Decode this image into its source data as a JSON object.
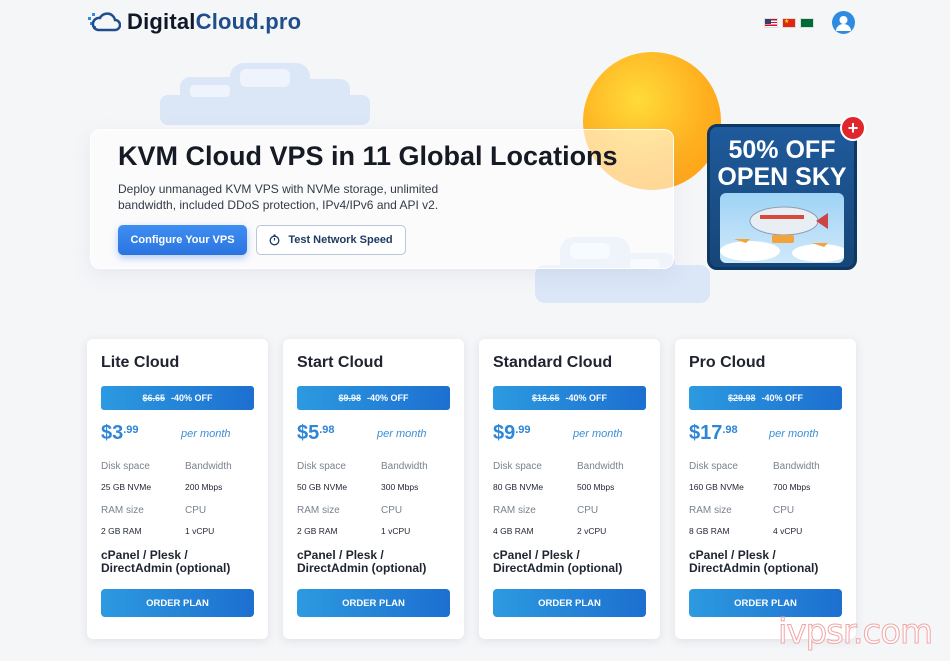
{
  "brand": {
    "name_main": "Digital",
    "name_accent": "Cloud.pro"
  },
  "header": {
    "languages": [
      "English",
      "Chinese",
      "Arabic"
    ],
    "user_icon": "user-icon"
  },
  "hero": {
    "title": "KVM Cloud VPS in 11 Global Locations",
    "description": "Deploy unmanaged KVM VPS with NVMe storage, unlimited bandwidth, included DDoS protection, IPv4/IPv6 and API v2.",
    "primary_button": "Configure Your VPS",
    "secondary_button": "Test Network Speed",
    "secondary_icon": "stopwatch-icon"
  },
  "promo": {
    "line1": "50% OFF",
    "line2": "OPEN SKY",
    "badge": "+"
  },
  "labels": {
    "per_month": "per month",
    "disk": "Disk space",
    "bandwidth": "Bandwidth",
    "ram": "RAM size",
    "cpu": "CPU",
    "panel": "cPanel / Plesk / DirectAdmin (optional)",
    "order": "ORDER PLAN"
  },
  "plans": [
    {
      "name": "Lite Cloud",
      "old_price": "$6.65",
      "discount": "-40% OFF",
      "currency": "$",
      "price_int": "3",
      "price_dec": ".99",
      "disk": "25 GB NVMe",
      "bandwidth": "200 Mbps",
      "ram": "2 GB RAM",
      "cpu": "1 vCPU"
    },
    {
      "name": "Start Cloud",
      "old_price": "$9.98",
      "discount": "-40% OFF",
      "currency": "$",
      "price_int": "5",
      "price_dec": ".98",
      "disk": "50 GB NVMe",
      "bandwidth": "300 Mbps",
      "ram": "2 GB RAM",
      "cpu": "1 vCPU"
    },
    {
      "name": "Standard Cloud",
      "old_price": "$16.65",
      "discount": "-40% OFF",
      "currency": "$",
      "price_int": "9",
      "price_dec": ".99",
      "disk": "80 GB NVMe",
      "bandwidth": "500 Mbps",
      "ram": "4 GB RAM",
      "cpu": "2 vCPU"
    },
    {
      "name": "Pro Cloud",
      "old_price": "$29.98",
      "discount": "-40% OFF",
      "currency": "$",
      "price_int": "17",
      "price_dec": ".98",
      "disk": "160 GB NVMe",
      "bandwidth": "700 Mbps",
      "ram": "8 GB RAM",
      "cpu": "4 vCPU"
    }
  ],
  "watermark": "ivpsr.com",
  "colors": {
    "accent": "#2d86d6",
    "button": "#2b74e0",
    "promo_bg": "#1f5a9c"
  }
}
